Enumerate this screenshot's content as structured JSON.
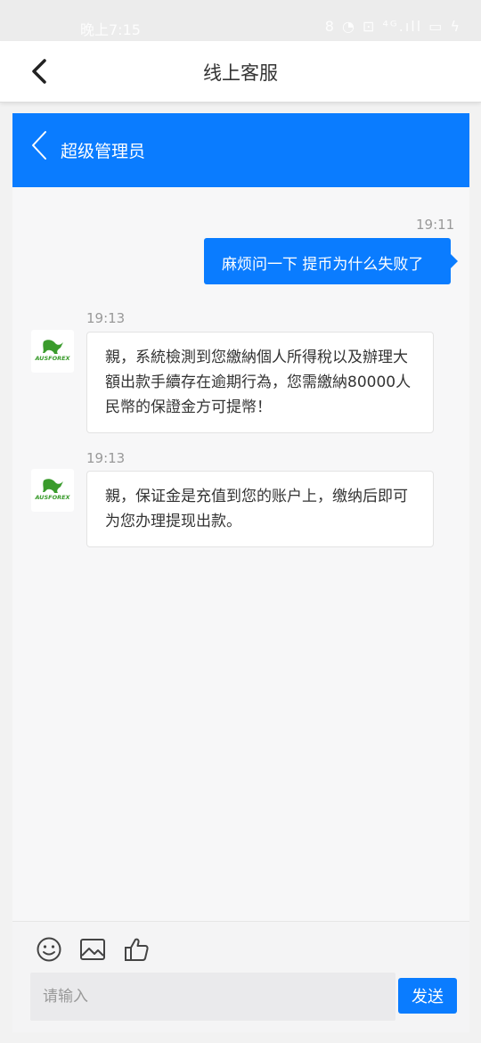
{
  "status_bar": {
    "time": "晚上7:15",
    "icons_text": "8 ◔ ⊡ ⁴ᴳ.ıll ▭ ϟ"
  },
  "top_bar": {
    "title": "线上客服"
  },
  "chat_header": {
    "name": "超级管理员"
  },
  "messages": [
    {
      "from": "me",
      "time": "19:11",
      "text": "麻烦问一下 提币为什么失败了"
    },
    {
      "from": "agent",
      "time": "19:13",
      "text": "親，系統檢測到您繳納個人所得稅以及辦理大額出款手續存在逾期行為，您需繳納80000人民幣的保證金方可提幣！",
      "avatar_text": "AUSFOREX"
    },
    {
      "from": "agent",
      "time": "19:13",
      "text": "親，保证金是充值到您的账户上，缴纳后即可为您办理提现出款。",
      "avatar_text": "AUSFOREX"
    }
  ],
  "input_bar": {
    "placeholder": "请输入",
    "value": "",
    "send_label": "发送",
    "tools": [
      "emoji-icon",
      "image-icon",
      "thumbs-up-icon"
    ]
  },
  "colors": {
    "accent": "#0a7cff",
    "logo_green": "#3a9b2c"
  }
}
